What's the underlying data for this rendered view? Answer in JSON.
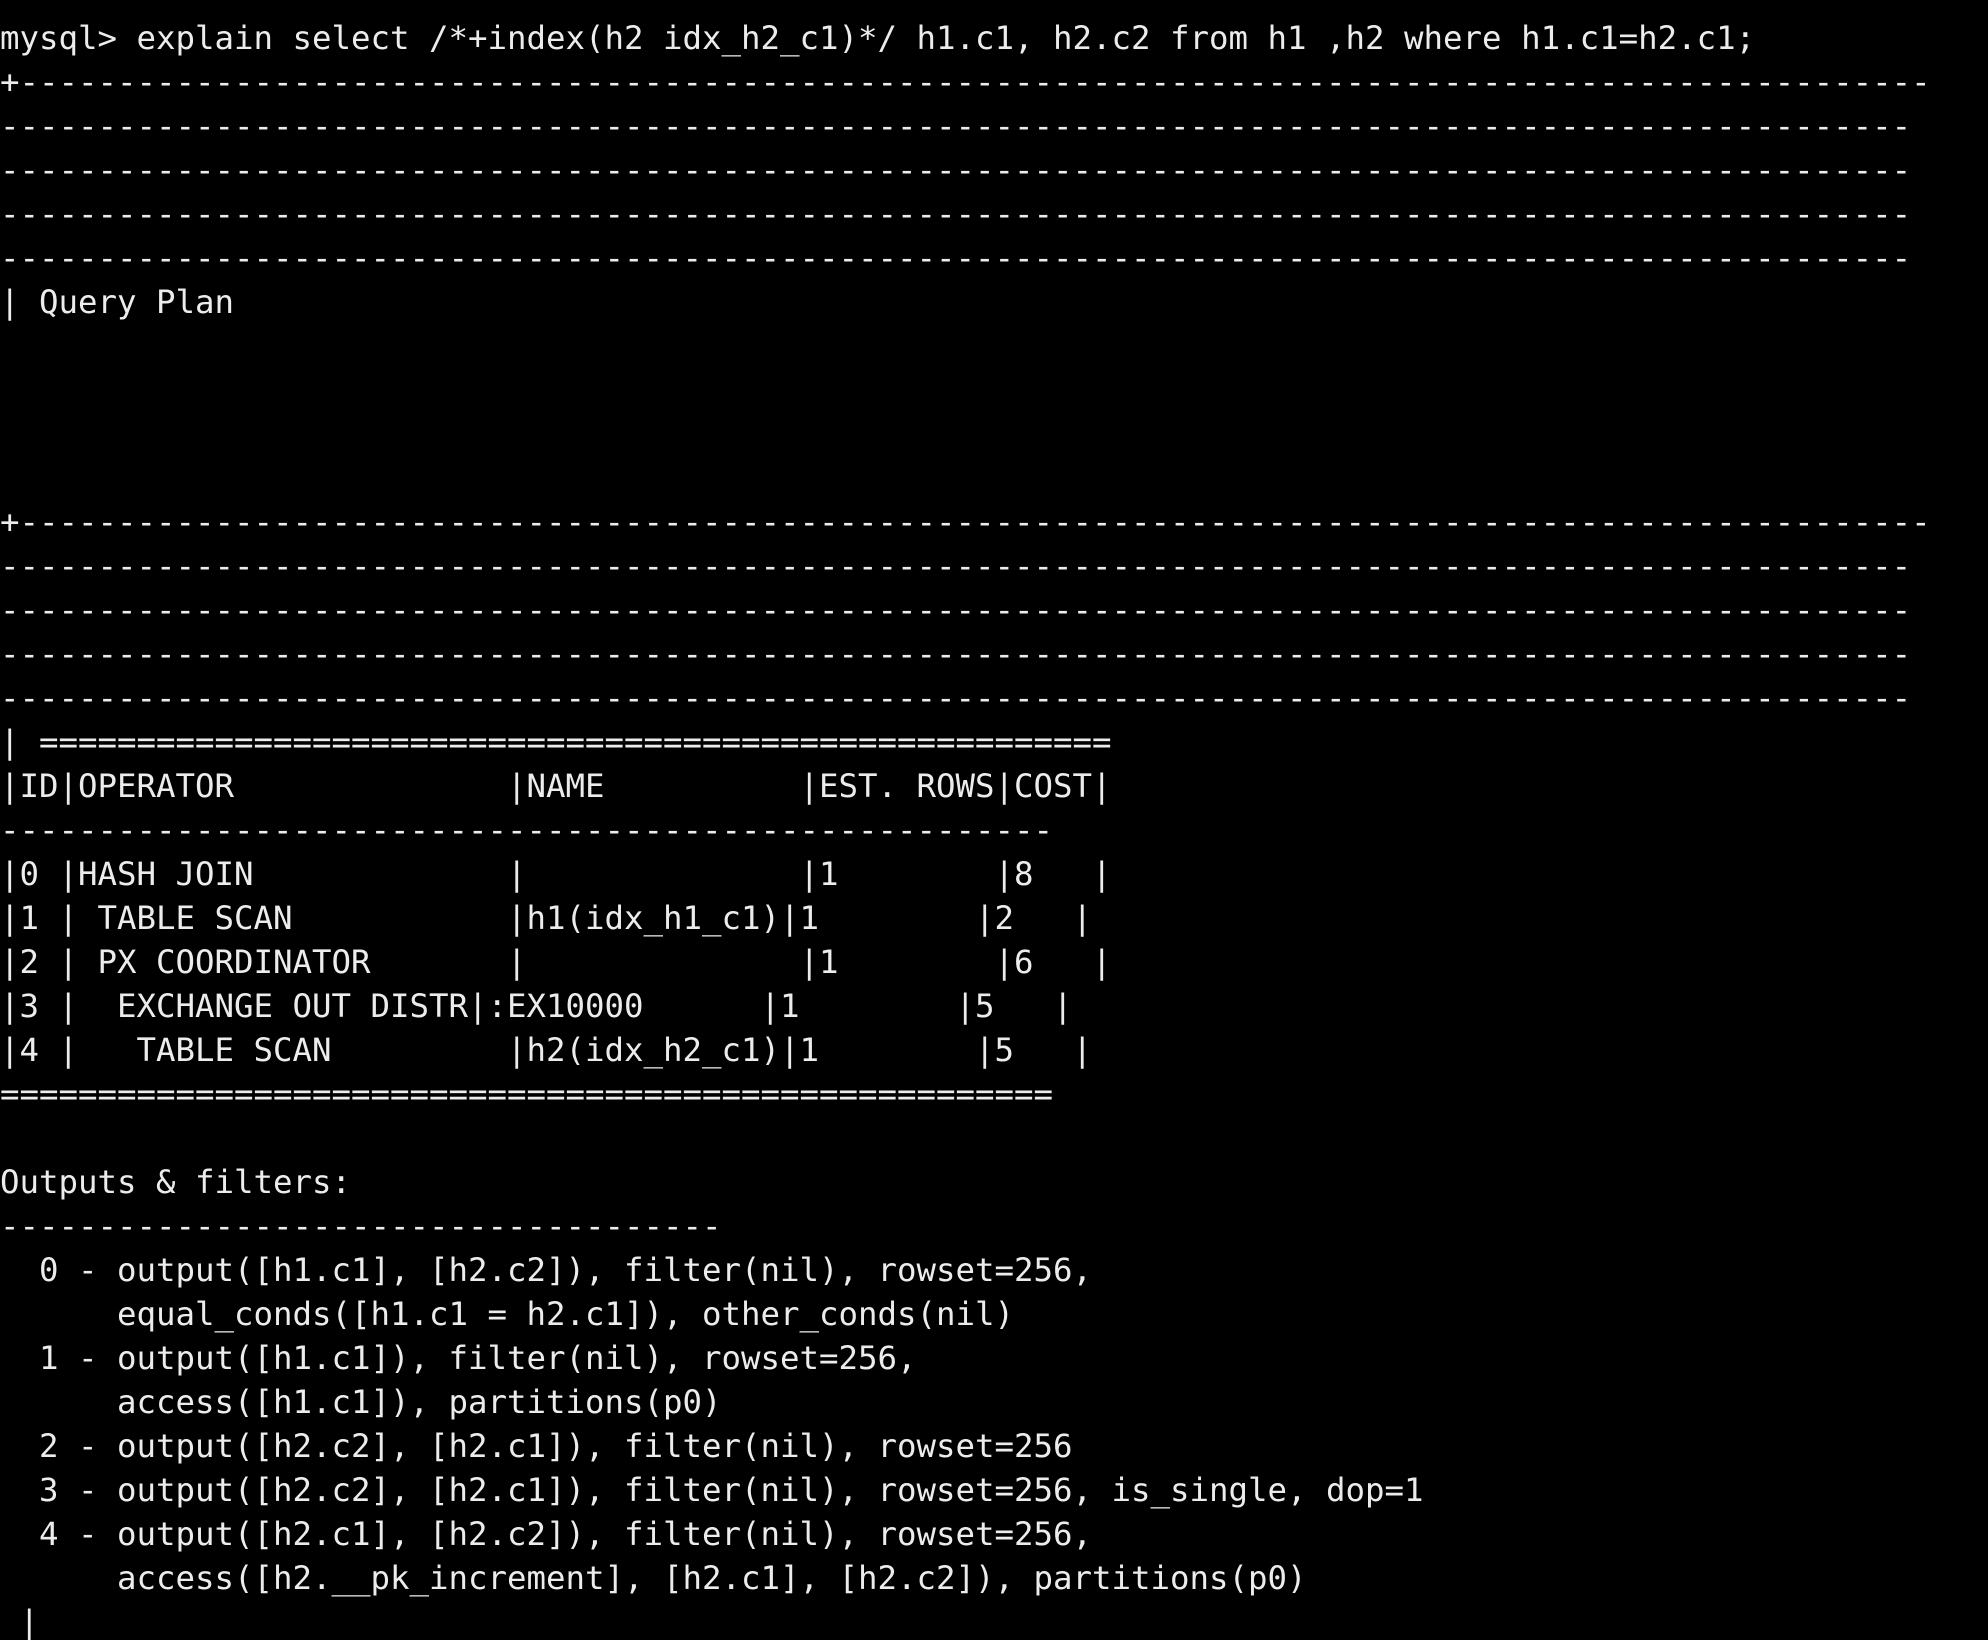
{
  "terminal": {
    "lines": [
      "mysql> explain select /*+index(h2 idx_h2_c1)*/ h1.c1, h2.c2 from h1 ,h2 where h1.c1=h2.c1;",
      "+--------------------------------------------------------------------------------------------------",
      "--------------------------------------------------------------------------------------------------",
      "--------------------------------------------------------------------------------------------------",
      "--------------------------------------------------------------------------------------------------",
      "--------------------------------------------------------------------------------------------------",
      "| Query Plan",
      "",
      "",
      "",
      "",
      "+--------------------------------------------------------------------------------------------------",
      "--------------------------------------------------------------------------------------------------",
      "--------------------------------------------------------------------------------------------------",
      "--------------------------------------------------------------------------------------------------",
      "--------------------------------------------------------------------------------------------------",
      "| =======================================================",
      "|ID|OPERATOR              |NAME          |EST. ROWS|COST|",
      "------------------------------------------------------",
      "|0 |HASH JOIN             |              |1        |8   |",
      "|1 | TABLE SCAN           |h1(idx_h1_c1)|1        |2   |",
      "|2 | PX COORDINATOR       |              |1        |6   |",
      "|3 |  EXCHANGE OUT DISTR|:EX10000      |1        |5   |",
      "|4 |   TABLE SCAN         |h2(idx_h2_c1)|1        |5   |",
      "======================================================",
      "",
      "Outputs & filters:",
      "-------------------------------------",
      "  0 - output([h1.c1], [h2.c2]), filter(nil), rowset=256,",
      "      equal_conds([h1.c1 = h2.c1]), other_conds(nil)",
      "  1 - output([h1.c1]), filter(nil), rowset=256,",
      "      access([h1.c1]), partitions(p0)",
      "  2 - output([h2.c2], [h2.c1]), filter(nil), rowset=256",
      "  3 - output([h2.c2], [h2.c1]), filter(nil), rowset=256, is_single, dop=1",
      "  4 - output([h2.c1], [h2.c2]), filter(nil), rowset=256,",
      "      access([h2.__pk_increment], [h2.c1], [h2.c2]), partitions(p0)",
      " |"
    ]
  }
}
